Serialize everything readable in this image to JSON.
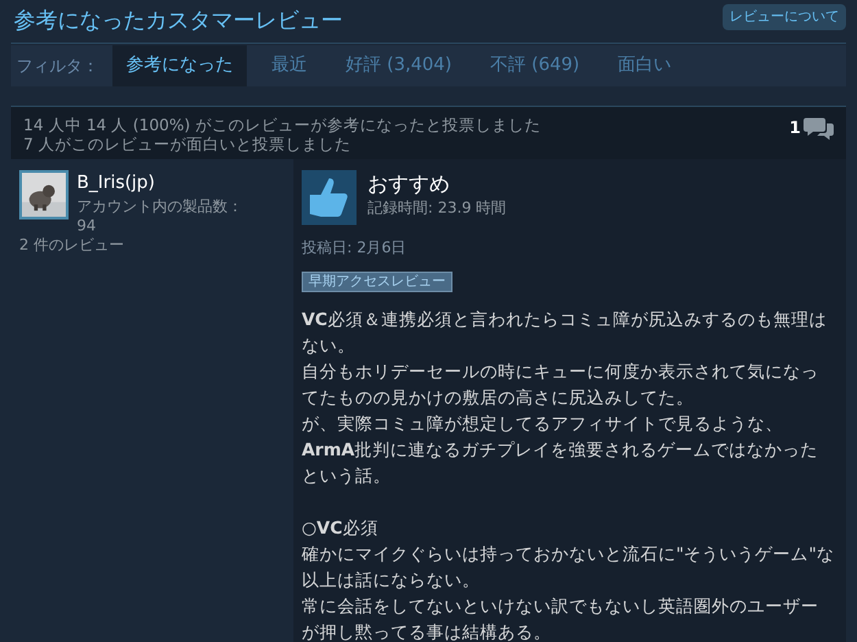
{
  "header": {
    "title": "参考になったカスタマーレビュー",
    "about_button": "レビューについて"
  },
  "filter": {
    "label": "フィルタ：",
    "tabs": [
      {
        "label": "参考になった",
        "selected": true
      },
      {
        "label": "最近",
        "selected": false
      },
      {
        "label": "好評 (3,404)",
        "selected": false
      },
      {
        "label": "不評 (649)",
        "selected": false
      },
      {
        "label": "面白い",
        "selected": false
      }
    ]
  },
  "review": {
    "helpful_votes": "14 人中 14 人 (100%) がこのレビューが参考になったと投票しました",
    "funny_votes": "7 人がこのレビューが面白いと投票しました",
    "comment_count": "1",
    "author": {
      "name": "B_Iris(jp)",
      "products_label": "アカウント内の製品数：",
      "products_count": "94",
      "reviews": "2 件のレビュー"
    },
    "verdict": "おすすめ",
    "playtime": "記録時間: 23.9 時間",
    "posted": "投稿日: 2月6日",
    "tag": "早期アクセスレビュー",
    "body_sections": [
      [
        "**VC**必須＆連携必須と言われたらコミュ障が尻込みするのも無理はない。",
        "自分もホリデーセールの時にキューに何度か表示されて気になってたものの見かけの敷居の高さに尻込みしてた。",
        "が、実際コミュ障が想定してるアフィサイトで見るような、",
        "**ArmA**批判に連なるガチプレイを強要されるゲームではなかったという話。"
      ],
      [
        "○**VC**必須",
        "確かにマイクぐらいは持っておかないと流石に\"そういうゲーム\"な以上は話にならない。",
        "常に会話をしてないといけない訳でもないし英語圏外のユーザーが押し黙ってる事は結構ある。"
      ]
    ]
  }
}
